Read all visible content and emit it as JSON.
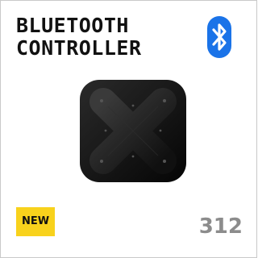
{
  "card": {
    "title_line1": "BLUETOOTH",
    "title_line2": "CONTROLLER",
    "badge_label": "NEW",
    "product_number": "312",
    "badge_color": "#f8d21c",
    "bluetooth_color": "#1a73e8",
    "title_color": "#111111",
    "number_color": "#8c8c8c"
  },
  "icons": {
    "brand": "bluetooth-icon",
    "product": "x-shaped-controller-icon"
  }
}
